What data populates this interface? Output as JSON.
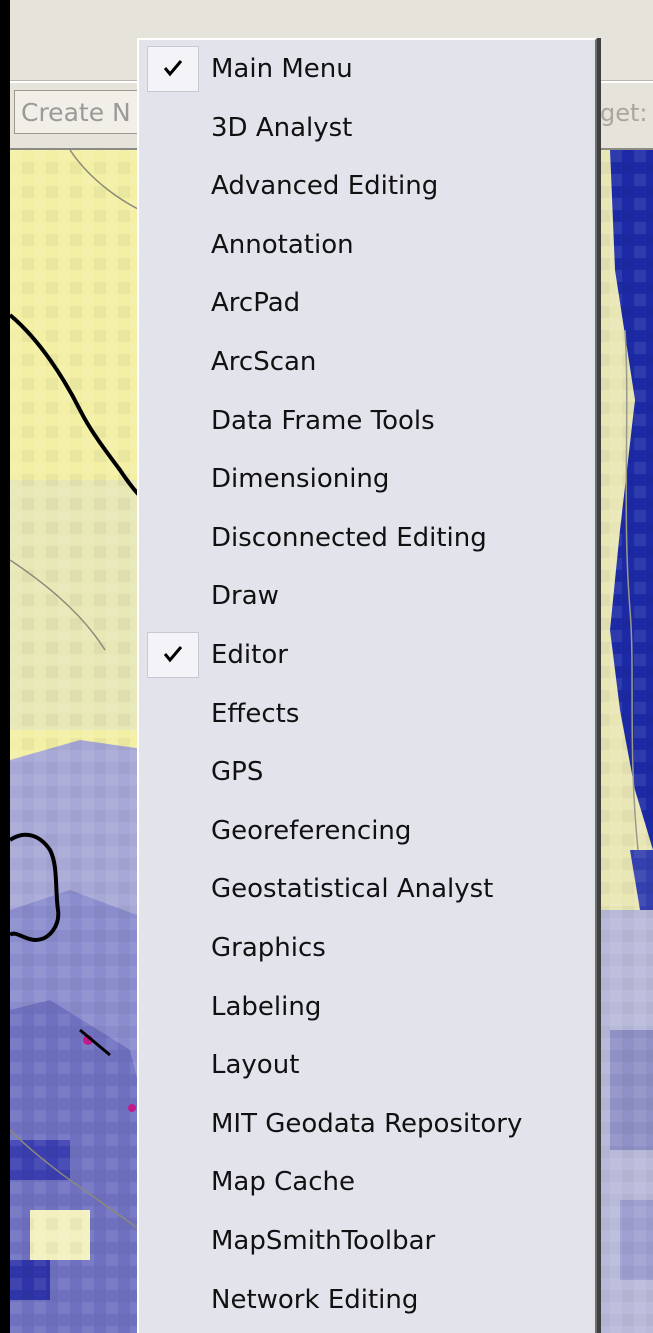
{
  "toolbar": {
    "create_new_text": "Create N",
    "target_label_text": "get:"
  },
  "menu": {
    "items": [
      {
        "label": "Main Menu",
        "checked": true
      },
      {
        "label": "3D Analyst",
        "checked": false
      },
      {
        "label": "Advanced Editing",
        "checked": false
      },
      {
        "label": "Annotation",
        "checked": false
      },
      {
        "label": "ArcPad",
        "checked": false
      },
      {
        "label": "ArcScan",
        "checked": false
      },
      {
        "label": "Data Frame Tools",
        "checked": false
      },
      {
        "label": "Dimensioning",
        "checked": false
      },
      {
        "label": "Disconnected Editing",
        "checked": false
      },
      {
        "label": "Draw",
        "checked": false
      },
      {
        "label": "Editor",
        "checked": true
      },
      {
        "label": "Effects",
        "checked": false
      },
      {
        "label": "GPS",
        "checked": false
      },
      {
        "label": "Georeferencing",
        "checked": false
      },
      {
        "label": "Geostatistical Analyst",
        "checked": false
      },
      {
        "label": "Graphics",
        "checked": false
      },
      {
        "label": "Labeling",
        "checked": false
      },
      {
        "label": "Layout",
        "checked": false
      },
      {
        "label": "MIT Geodata Repository",
        "checked": false
      },
      {
        "label": "Map Cache",
        "checked": false
      },
      {
        "label": "MapSmithToolbar",
        "checked": false
      },
      {
        "label": "Network Editing",
        "checked": false
      }
    ]
  },
  "colors": {
    "menu_background": "#e2e3eb",
    "map_yellow": "#f3f0a6",
    "map_blue": "#1c2aa6"
  }
}
